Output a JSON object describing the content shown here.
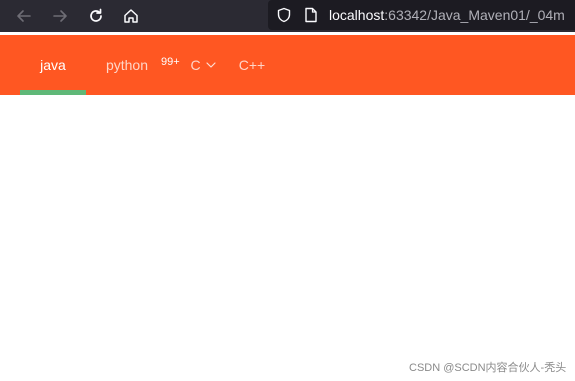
{
  "browser": {
    "url_host": "localhost",
    "url_rest": ":63342/Java_Maven01/_04m",
    "colors": {
      "toolbar": "#2b2a33",
      "urlbar": "#1c1b22"
    },
    "icons": [
      "arrow-back-icon",
      "arrow-forward-icon",
      "reload-icon",
      "home-icon",
      "shield-icon",
      "page-icon"
    ]
  },
  "navbar": {
    "background": "#ff5722",
    "active_indicator_color": "#5fb878",
    "items": [
      {
        "label": "java",
        "active": true
      },
      {
        "label": "python",
        "active": false,
        "badge": "99+"
      },
      {
        "label": "C",
        "active": false,
        "has_dropdown": true
      },
      {
        "label": "C++",
        "active": false
      }
    ]
  },
  "watermark": "CSDN @SCDN内容合伙人-秃头"
}
